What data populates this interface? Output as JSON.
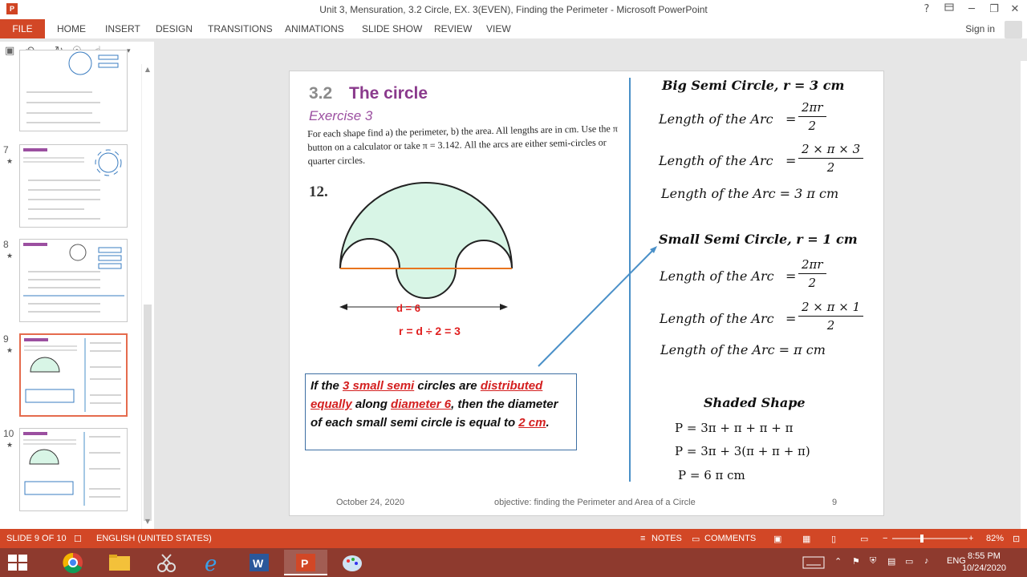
{
  "window": {
    "app_icon": "P",
    "title": "Unit 3, Mensuration, 3.2 Circle, EX. 3(EVEN), Finding the Perimeter - Microsoft PowerPoint",
    "help": "?",
    "minimize": "─",
    "restore": "❐",
    "close": "✕"
  },
  "ribbon": {
    "file": "FILE",
    "tabs": [
      "HOME",
      "INSERT",
      "DESIGN",
      "TRANSITIONS",
      "ANIMATIONS",
      "SLIDE SHOW",
      "REVIEW",
      "VIEW"
    ],
    "signin": "Sign in"
  },
  "thumbnails": {
    "numbers": [
      "7",
      "8",
      "9",
      "10"
    ],
    "star": "★",
    "active_index": 2
  },
  "slide": {
    "section_number": "3.2",
    "section_title": "The circle",
    "exercise": "Exercise 3",
    "instructions": "For each shape find a) the perimeter, b) the area. All lengths are in cm. Use the π button on a calculator or take π = 3.142. All the arcs are either semi-circles or quarter circles.",
    "question_number": "12.",
    "diameter_label": "d = 6",
    "radius_label": "r = d ÷ 2 = 3",
    "info_box": {
      "p1": "If the ",
      "h1": "3 small semi",
      "p2": " circles are ",
      "h2": "distributed equally",
      "p3": " along ",
      "h3": "diameter 6",
      "p4": ", then the diameter of each small semi circle is equal to ",
      "h4": "2 cm",
      "p5": "."
    },
    "big": {
      "heading": "Big Semi Circle, r = 3 cm",
      "arc_label": "Length of the Arc",
      "eq": "=",
      "f1_num": "2πr",
      "f1_den": "2",
      "f2_num": "2 × π × 3",
      "f2_den": "2",
      "result": "Length of the Arc  = 3 π cm"
    },
    "small": {
      "heading": "Small Semi Circle, r = 1 cm",
      "arc_label": "Length of the Arc",
      "eq": "=",
      "f1_num": "2πr",
      "f1_den": "2",
      "f2_num": "2 × π × 1",
      "f2_den": "2",
      "result": "Length of the Arc  = π cm"
    },
    "shaded": {
      "heading": "Shaded Shape",
      "line1": "P = 3π + π + π + π",
      "line2": "P = 3π + 3(π + π + π)",
      "line3": "P = 6 π cm"
    },
    "footer": {
      "date": "October 24, 2020",
      "objective": "objective: finding the Perimeter and Area of a Circle",
      "page": "9"
    }
  },
  "statusbar": {
    "slide_info": "SLIDE 9 OF 10",
    "language": "ENGLISH (UNITED STATES)",
    "notes": "NOTES",
    "comments": "COMMENTS",
    "zoom": "82%"
  },
  "taskbar": {
    "language": "ENG",
    "time": "8:55 PM",
    "date": "10/24/2020"
  },
  "colors": {
    "accent": "#d24726",
    "taskbar": "#8e3a2e",
    "highlight": "#d42020",
    "divider": "#4a90c8",
    "shape_fill": "#d8f5e6"
  }
}
